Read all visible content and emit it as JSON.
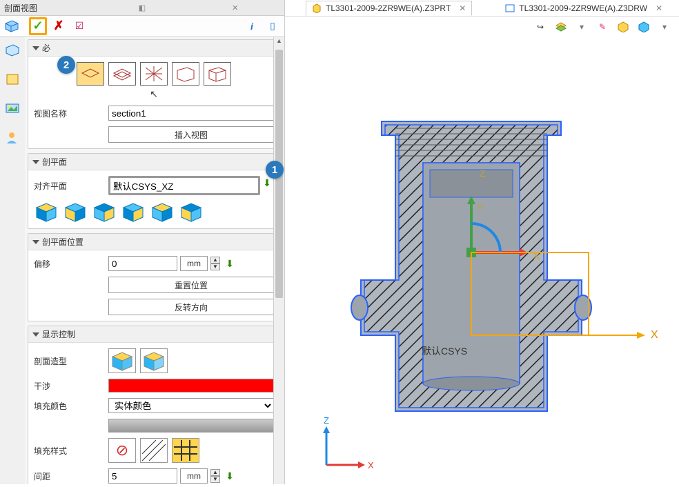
{
  "panel": {
    "title": "剖面视图",
    "sections": {
      "required": "必",
      "section_plane": "剖平面",
      "section_plane_pos": "剖平面位置",
      "display_ctrl": "显示控制"
    },
    "labels": {
      "view_name": "视图名称",
      "insert_view": "插入视图",
      "align_plane": "对齐平面",
      "offset": "偏移",
      "reset_pos": "重置位置",
      "flip_dir": "反转方向",
      "section_shape": "剖面造型",
      "interference": "干涉",
      "fill_color": "填充颜色",
      "fill_style": "填充样式",
      "spacing": "间距"
    },
    "values": {
      "view_name": "section1",
      "align_plane": "默认CSYS_XZ",
      "offset": "0",
      "offset_unit": "mm",
      "fill_color_sel": "实体颜色",
      "spacing": "5",
      "spacing_unit": "mm"
    },
    "callouts": {
      "step1": "1",
      "step2": "2"
    }
  },
  "tabs": {
    "prt": "TL3301-2009-2ZR9WE(A).Z3PRT",
    "drw": "TL3301-2009-2ZR9WE(A).Z3DRW"
  },
  "canvas": {
    "csys_label": "默认CSYS",
    "axes": {
      "x": "X",
      "y": "Y",
      "z": "Z"
    }
  }
}
